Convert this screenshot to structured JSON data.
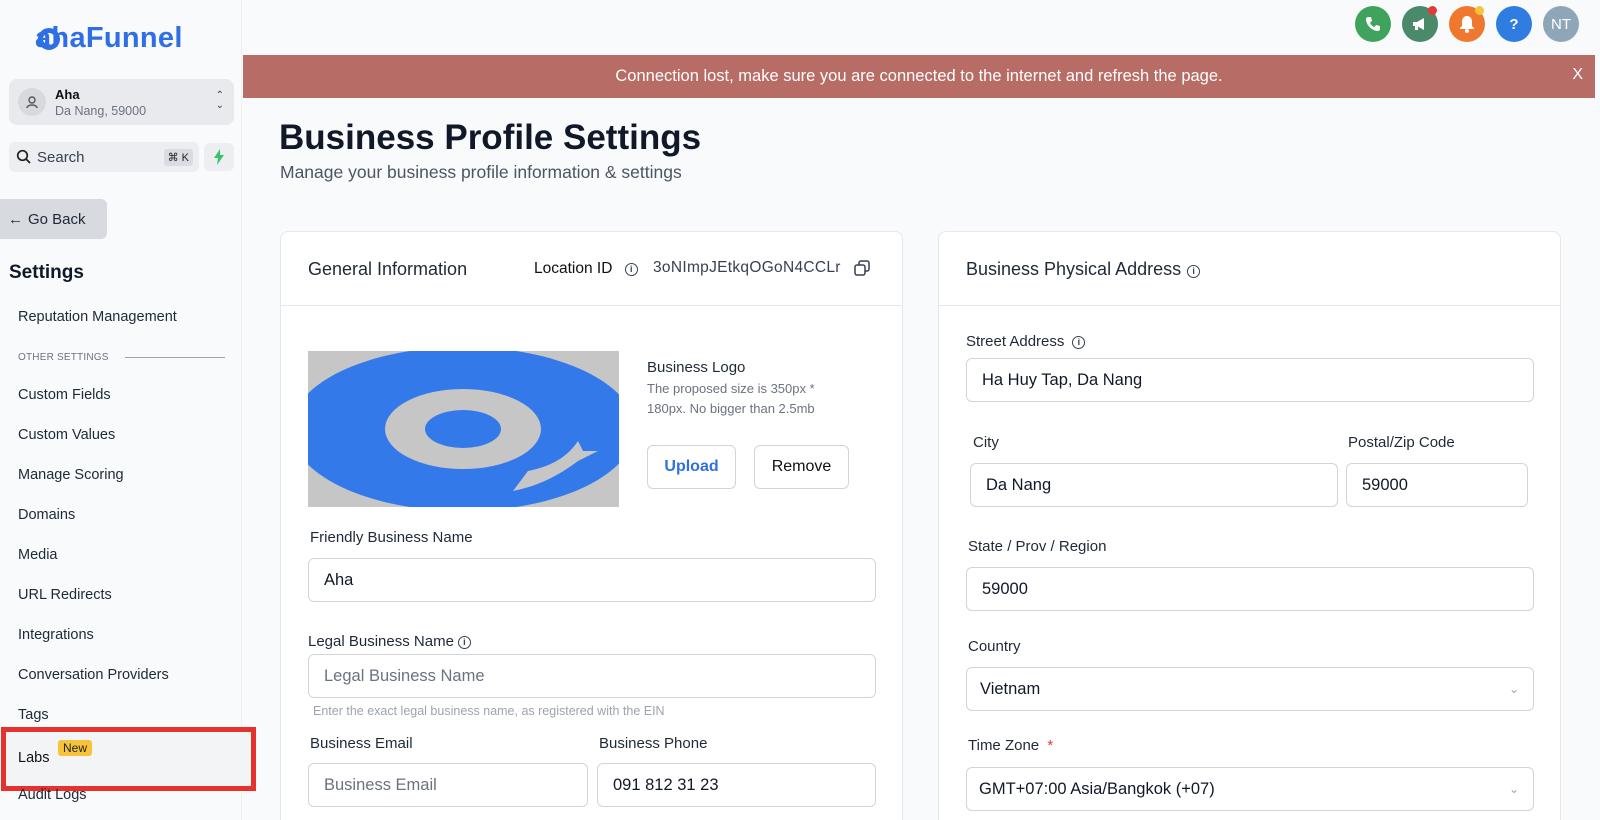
{
  "brand": {
    "logo_text": "ahaFunnel"
  },
  "account": {
    "name": "Aha",
    "location": "Da Nang, 59000"
  },
  "search": {
    "placeholder": "Search",
    "shortcut": "⌘ K"
  },
  "sidebar": {
    "go_back": "Go Back",
    "title": "Settings",
    "top_item": "Reputation Management",
    "section_label": "OTHER SETTINGS",
    "items": [
      "Custom Fields",
      "Custom Values",
      "Manage Scoring",
      "Domains",
      "Media",
      "URL Redirects",
      "Integrations",
      "Conversation Providers",
      "Tags"
    ],
    "labs": {
      "label": "Labs",
      "badge": "New"
    },
    "audit": "Audit Logs"
  },
  "topbar": {
    "avatar_initials": "NT",
    "help": "?"
  },
  "banner": {
    "message": "Connection lost, make sure you are connected to the internet and refresh the page.",
    "close": "X"
  },
  "page": {
    "title": "Business Profile Settings",
    "subtitle": "Manage your business profile information & settings"
  },
  "general": {
    "title": "General Information",
    "location_id_label": "Location ID",
    "location_id": "3oNImpJEtkqOGoN4CCLr",
    "logo_label": "Business Logo",
    "logo_hint_1": "The proposed size is 350px *",
    "logo_hint_2": "180px. No bigger than 2.5mb",
    "upload": "Upload",
    "remove": "Remove",
    "friendly_label": "Friendly Business Name",
    "friendly_value": "Aha",
    "legal_label": "Legal Business Name",
    "legal_placeholder": "Legal Business Name",
    "legal_help": "Enter the exact legal business name, as registered with the EIN",
    "email_label": "Business Email",
    "email_placeholder": "Business Email",
    "phone_label": "Business Phone",
    "phone_value": "091 812 31 23"
  },
  "address": {
    "title": "Business Physical Address",
    "street_label": "Street Address",
    "street_value": "Ha Huy Tap, Da Nang",
    "city_label": "City",
    "city_value": "Da Nang",
    "zip_label": "Postal/Zip Code",
    "zip_value": "59000",
    "state_label": "State / Prov / Region",
    "state_value": "59000",
    "country_label": "Country",
    "country_value": "Vietnam",
    "tz_label": "Time Zone",
    "tz_required": "*",
    "tz_value": "GMT+07:00 Asia/Bangkok (+07)"
  },
  "colors": {
    "brand": "#2f6fe6",
    "banner": "#b86c66",
    "highlight": "#e5322d",
    "badge": "#f7c33a"
  }
}
